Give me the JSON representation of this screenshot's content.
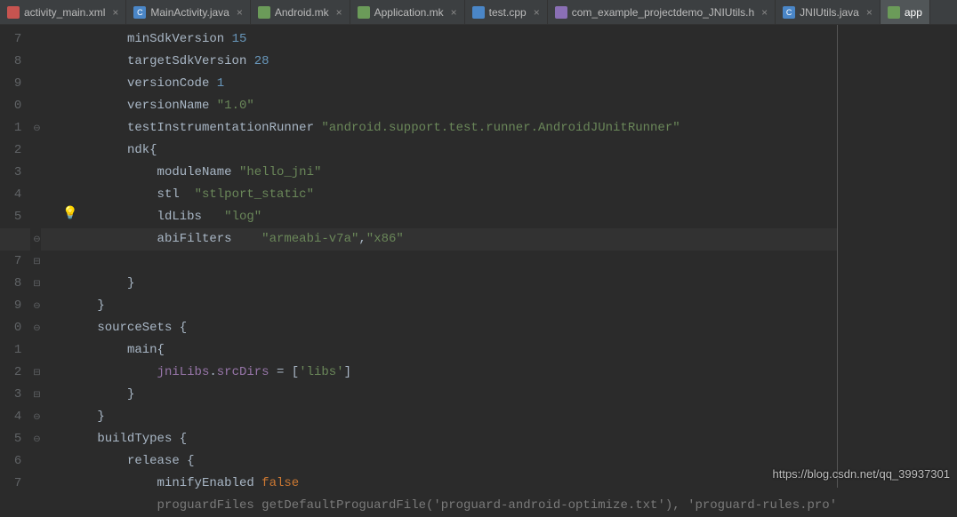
{
  "tabs": [
    {
      "label": "activity_main.xml",
      "icon": "ic-xml",
      "closable": true
    },
    {
      "label": "MainActivity.java",
      "icon": "ic-java",
      "closable": true
    },
    {
      "label": "Android.mk",
      "icon": "ic-mk",
      "closable": true
    },
    {
      "label": "Application.mk",
      "icon": "ic-mk",
      "closable": true
    },
    {
      "label": "test.cpp",
      "icon": "ic-cpp",
      "closable": true
    },
    {
      "label": "com_example_projectdemo_JNIUtils.h",
      "icon": "ic-h",
      "closable": true
    },
    {
      "label": "JNIUtils.java",
      "icon": "ic-java",
      "closable": true
    },
    {
      "label": "app",
      "icon": "ic-app",
      "closable": false,
      "active": true
    }
  ],
  "first_line": 7,
  "lines": [
    {
      "ind": 8,
      "tk": [
        {
          "t": "minSdkVersion "
        },
        {
          "t": "15",
          "c": "k-num"
        }
      ]
    },
    {
      "ind": 8,
      "tk": [
        {
          "t": "targetSdkVersion "
        },
        {
          "t": "28",
          "c": "k-num"
        }
      ]
    },
    {
      "ind": 8,
      "tk": [
        {
          "t": "versionCode "
        },
        {
          "t": "1",
          "c": "k-num"
        }
      ]
    },
    {
      "ind": 8,
      "tk": [
        {
          "t": "versionName "
        },
        {
          "t": "\"1.0\"",
          "c": "k-str"
        }
      ]
    },
    {
      "ind": 8,
      "tk": [
        {
          "t": "testInstrumentationRunner "
        },
        {
          "t": "\"android.support.test.runner.AndroidJUnitRunner\"",
          "c": "k-str"
        }
      ]
    },
    {
      "ind": 8,
      "tk": [
        {
          "t": "ndk{"
        }
      ]
    },
    {
      "ind": 12,
      "tk": [
        {
          "t": "moduleName "
        },
        {
          "t": "\"hello_jni\"",
          "c": "k-str"
        }
      ]
    },
    {
      "ind": 12,
      "tk": [
        {
          "t": "stl  "
        },
        {
          "t": "\"stlport_static\"",
          "c": "k-str"
        }
      ]
    },
    {
      "ind": 12,
      "tk": [
        {
          "t": "ldLibs   "
        },
        {
          "t": "\"log\"",
          "c": "k-str"
        }
      ]
    },
    {
      "ind": 12,
      "hl": true,
      "tk": [
        {
          "t": "abiFilters    "
        },
        {
          "t": "\"armeabi-v7a\"",
          "c": "k-str"
        },
        {
          "t": ","
        },
        {
          "t": "\"x86\"",
          "c": "k-str"
        }
      ]
    },
    {
      "ind": 8,
      "tk": [
        {
          "t": "}"
        }
      ]
    },
    {
      "ind": 4,
      "tk": [
        {
          "t": "}"
        }
      ]
    },
    {
      "ind": 4,
      "tk": [
        {
          "t": "sourceSets {"
        }
      ]
    },
    {
      "ind": 8,
      "tk": [
        {
          "t": "main{"
        }
      ]
    },
    {
      "ind": 12,
      "tk": [
        {
          "t": "jniLibs",
          "c": "k-id1"
        },
        {
          "t": "."
        },
        {
          "t": "srcDirs",
          "c": "k-id2"
        },
        {
          "t": " = ["
        },
        {
          "t": "'libs'",
          "c": "k-str"
        },
        {
          "t": "]"
        }
      ]
    },
    {
      "ind": 8,
      "tk": [
        {
          "t": "}"
        }
      ]
    },
    {
      "ind": 4,
      "tk": [
        {
          "t": "}"
        }
      ]
    },
    {
      "ind": 4,
      "tk": [
        {
          "t": "buildTypes {"
        }
      ]
    },
    {
      "ind": 8,
      "tk": [
        {
          "t": "release {"
        }
      ]
    },
    {
      "ind": 12,
      "tk": [
        {
          "t": "minifyEnabled "
        },
        {
          "t": "false",
          "c": "k-false"
        }
      ]
    },
    {
      "ind": 12,
      "cut": true,
      "tk": [
        {
          "t": "proguardFiles getDefaultProguardFile("
        },
        {
          "t": "'proguard-android-optimize.txt'",
          "c": "k-str"
        },
        {
          "t": "), "
        },
        {
          "t": "'proguard-rules.pro'",
          "c": "k-str"
        }
      ]
    }
  ],
  "folds": [
    {
      "row": 5,
      "sym": "⊖"
    },
    {
      "row": 10,
      "sym": "⊖",
      "bulb": true
    },
    {
      "row": 11,
      "sym": "⊟"
    },
    {
      "row": 12,
      "sym": "⊟"
    },
    {
      "row": 13,
      "sym": "⊖"
    },
    {
      "row": 14,
      "sym": "⊖"
    },
    {
      "row": 16,
      "sym": "⊟"
    },
    {
      "row": 17,
      "sym": "⊟"
    },
    {
      "row": 18,
      "sym": "⊖"
    },
    {
      "row": 19,
      "sym": "⊖"
    }
  ],
  "watermark": "https://blog.csdn.net/qq_39937301"
}
